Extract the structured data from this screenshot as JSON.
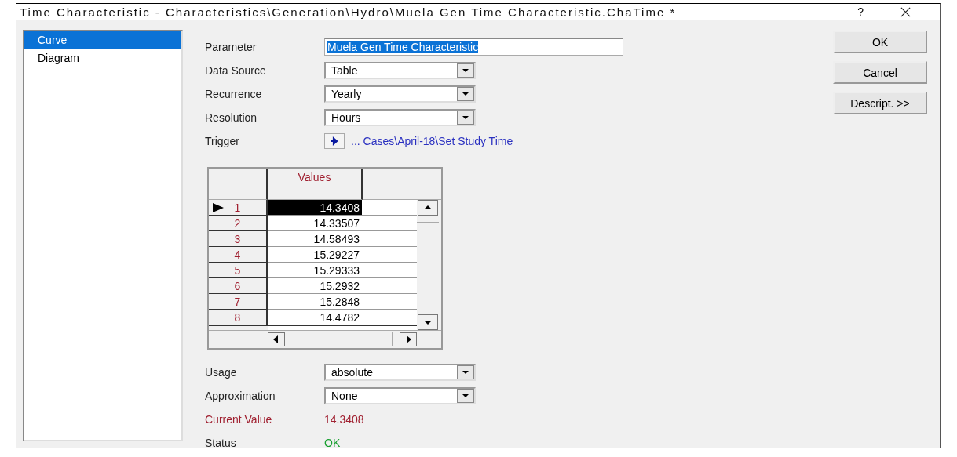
{
  "window": {
    "title": "Time Characteristic - Characteristics\\Generation\\Hydro\\Muela Gen Time Characteristic.ChaTime *",
    "help": "?"
  },
  "sidebar": {
    "items": [
      {
        "label": "Curve",
        "selected": true
      },
      {
        "label": "Diagram",
        "selected": false
      }
    ]
  },
  "fields": [
    {
      "kind": "text",
      "label": "Parameter",
      "value": "Muela Gen Time Characteristic",
      "selected": true
    },
    {
      "kind": "dropdown",
      "label": "Data Source",
      "value": "Table"
    },
    {
      "kind": "dropdown",
      "label": "Recurrence",
      "value": "Yearly"
    },
    {
      "kind": "dropdown",
      "label": "Resolution",
      "value": "Hours"
    },
    {
      "kind": "link",
      "label": "Trigger",
      "value": "... Cases\\April-18\\Set Study Time"
    }
  ],
  "table": {
    "columns": [
      "Values"
    ],
    "rows": [
      {
        "number": "1",
        "value": "14.3408",
        "selected": true
      },
      {
        "number": "2",
        "value": "14.33507",
        "selected": false
      },
      {
        "number": "3",
        "value": "14.58493",
        "selected": false
      },
      {
        "number": "4",
        "value": "15.29227",
        "selected": false
      },
      {
        "number": "5",
        "value": "15.29333",
        "selected": false
      },
      {
        "number": "6",
        "value": "15.2932",
        "selected": false
      },
      {
        "number": "7",
        "value": "15.2848",
        "selected": false
      },
      {
        "number": "8",
        "value": "14.4782",
        "selected": false
      }
    ]
  },
  "lower_fields": [
    {
      "kind": "dropdown",
      "label": "Usage",
      "value": "absolute"
    },
    {
      "kind": "dropdown",
      "label": "Approximation",
      "value": "None"
    },
    {
      "kind": "reading",
      "label": "Current Value",
      "value": "14.3408"
    },
    {
      "kind": "status",
      "label": "Status",
      "value": "OK"
    }
  ],
  "buttons": [
    "OK",
    "Cancel",
    "Descript. >>"
  ]
}
